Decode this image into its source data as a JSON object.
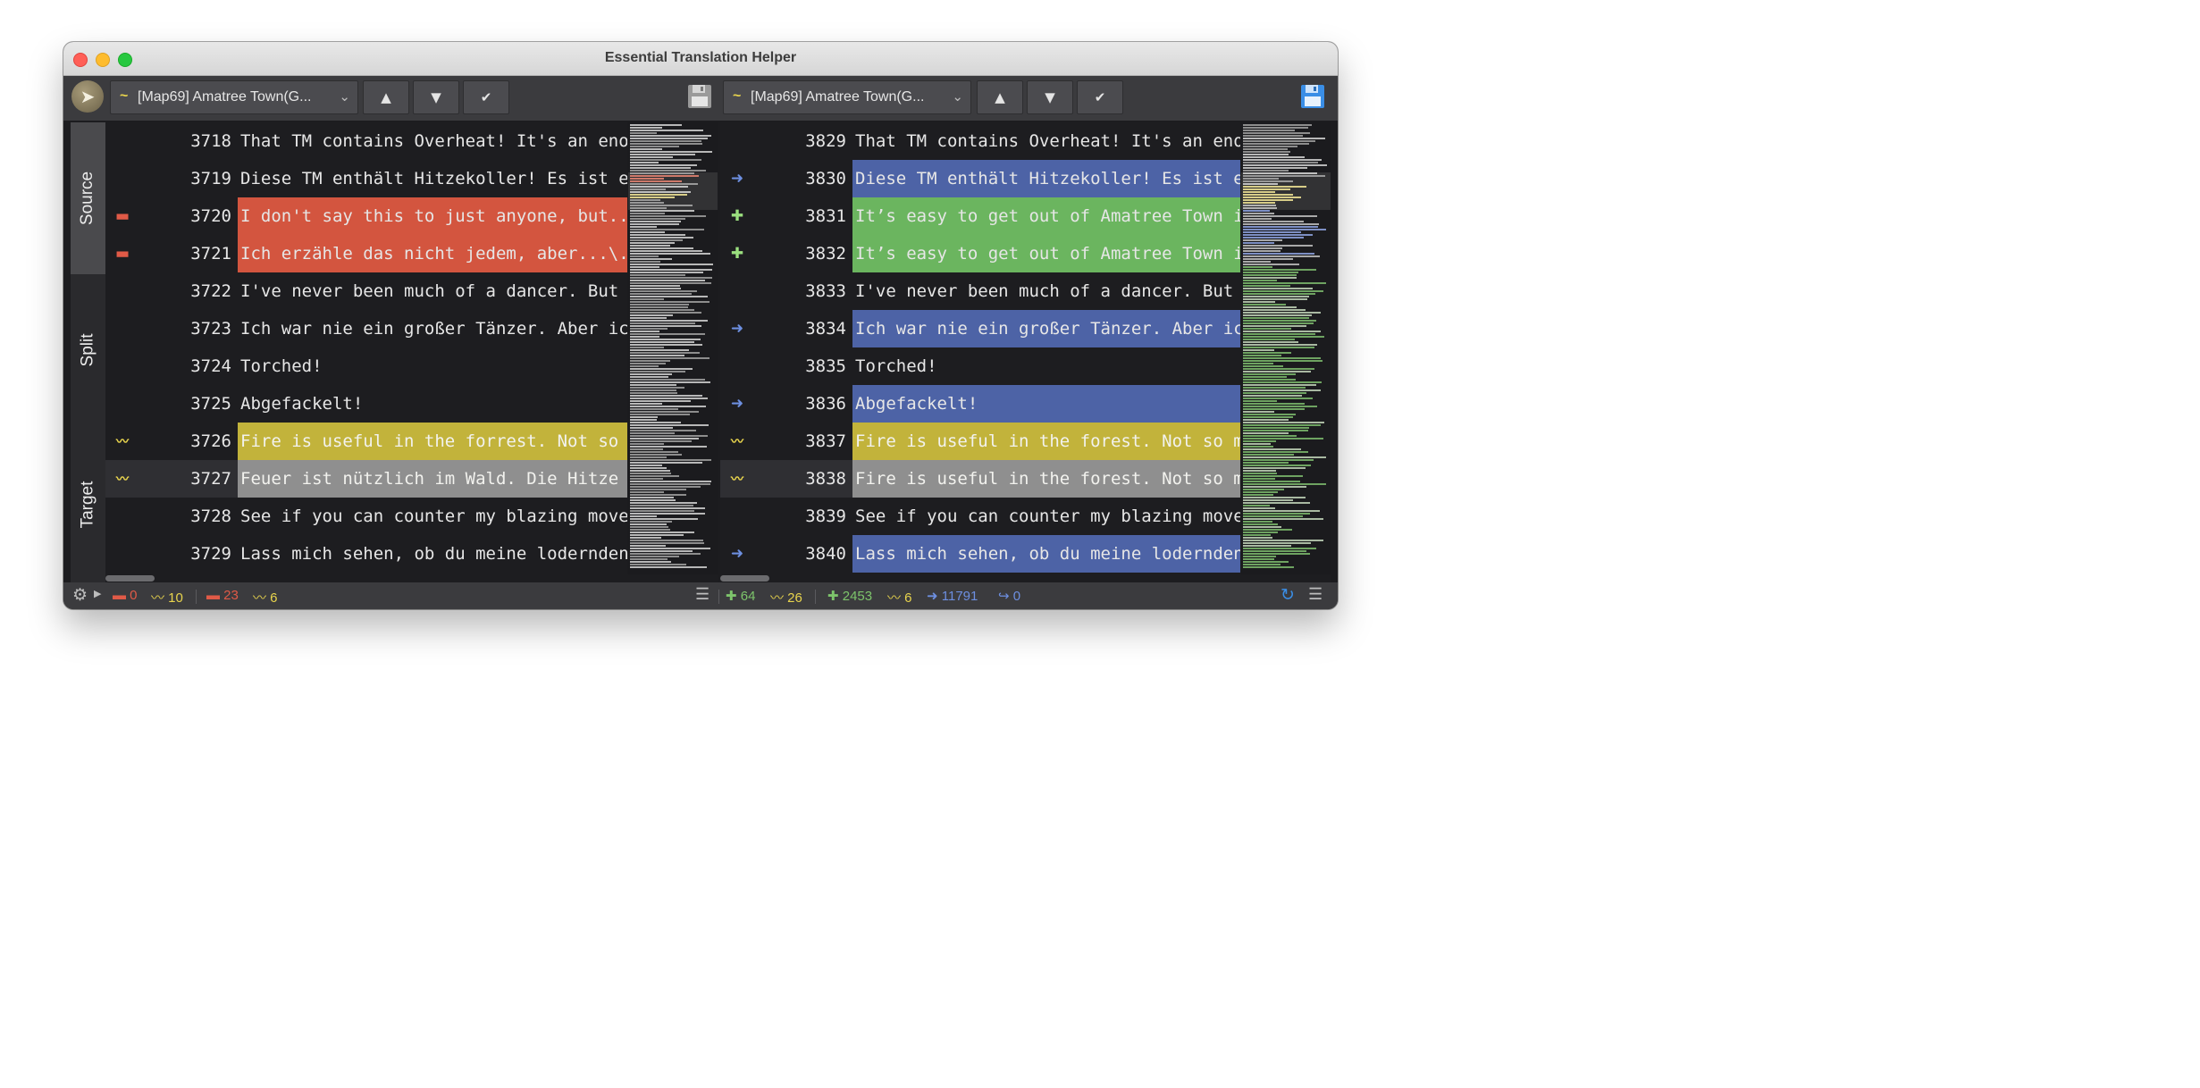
{
  "window": {
    "title": "Essential Translation Helper"
  },
  "colors": {
    "removed": "#d3553f",
    "added": "#6bb55f",
    "changed": "#4d63a6",
    "modified": "#c2b33b",
    "selected": "#8f8f8f",
    "text": "#e6e6e6"
  },
  "toolbar": {
    "left_combo": {
      "marker": "~",
      "text": "[Map69] Amatree Town(G..."
    },
    "right_combo": {
      "marker": "~",
      "text": "[Map69] Amatree Town(G..."
    },
    "buttons": {
      "up": "▲",
      "down": "▼",
      "accept": "✔"
    },
    "icons": [
      "app-logo-icon",
      "save-icon",
      "arrow-up-icon",
      "arrow-down-icon",
      "checkmark-icon"
    ]
  },
  "sidebar": {
    "tabs": [
      "Source",
      "Split",
      "Target"
    ],
    "active": "Source"
  },
  "left": {
    "lines": [
      {
        "num": "3718",
        "text": "That TM contains Overheat! It's an enor",
        "mark": "",
        "bg": ""
      },
      {
        "num": "3719",
        "text": "Diese TM enthält Hitzekoller! Es ist ei",
        "mark": "",
        "bg": ""
      },
      {
        "num": "3720",
        "text": "I don't say this to just anyone, but...",
        "mark": "minus",
        "bg": "removed"
      },
      {
        "num": "3721",
        "text": "Ich erzähle das nicht jedem, aber...\\.",
        "mark": "minus",
        "bg": "removed"
      },
      {
        "num": "3722",
        "text": "I've never been much of a dancer. But I",
        "mark": "",
        "bg": ""
      },
      {
        "num": "3723",
        "text": "Ich war nie ein großer Tänzer. Aber ich",
        "mark": "",
        "bg": ""
      },
      {
        "num": "3724",
        "text": "Torched!",
        "mark": "",
        "bg": ""
      },
      {
        "num": "3725",
        "text": "Abgefackelt!",
        "mark": "",
        "bg": ""
      },
      {
        "num": "3726",
        "text": "Fire is useful in the forrest. Not so m",
        "mark": "tilde",
        "bg": "modified"
      },
      {
        "num": "3727",
        "text": "Feuer ist nützlich im Wald. Die Hitze d",
        "mark": "tilde",
        "bg": "selected"
      },
      {
        "num": "3728",
        "text": "See if you can counter my blazing moves",
        "mark": "",
        "bg": ""
      },
      {
        "num": "3729",
        "text": "Lass mich sehen, ob du meine lodernden",
        "mark": "",
        "bg": ""
      }
    ]
  },
  "right": {
    "lines": [
      {
        "num": "3829",
        "text": "That TM contains Overheat! It's an enor",
        "mark": "",
        "bg": ""
      },
      {
        "num": "3830",
        "text": "Diese TM enthält Hitzekoller! Es ist ei",
        "mark": "arrow",
        "bg": "changed"
      },
      {
        "num": "3831",
        "text": "It’s easy to get out of Amatree Town if",
        "mark": "plus",
        "bg": "added"
      },
      {
        "num": "3832",
        "text": "It’s easy to get out of Amatree Town if",
        "mark": "plus",
        "bg": "added"
      },
      {
        "num": "3833",
        "text": "I've never been much of a dancer. But I",
        "mark": "",
        "bg": ""
      },
      {
        "num": "3834",
        "text": "Ich war nie ein großer Tänzer. Aber ich",
        "mark": "arrow",
        "bg": "changed"
      },
      {
        "num": "3835",
        "text": "Torched!",
        "mark": "",
        "bg": ""
      },
      {
        "num": "3836",
        "text": "Abgefackelt!",
        "mark": "arrow",
        "bg": "changed"
      },
      {
        "num": "3837",
        "text": "Fire is useful in the forest. Not so mu",
        "mark": "tilde",
        "bg": "modified"
      },
      {
        "num": "3838",
        "text": "Fire is useful in the forest. Not so mu",
        "mark": "tilde",
        "bg": "selected"
      },
      {
        "num": "3839",
        "text": "See if you can counter my blazing moves",
        "mark": "",
        "bg": ""
      },
      {
        "num": "3840",
        "text": "Lass mich sehen, ob du meine lodernden",
        "mark": "arrow",
        "bg": "changed"
      }
    ]
  },
  "status": {
    "left": {
      "removed_small": "0",
      "modified_small": "10",
      "removed": "23",
      "modified": "6"
    },
    "right": {
      "added_small": "64",
      "modified_small": "26",
      "added": "2453",
      "modified": "6",
      "changed": "11791",
      "moved": "0"
    },
    "icons": [
      "gear-icon",
      "hamburger-menu-icon",
      "refresh-icon"
    ]
  }
}
